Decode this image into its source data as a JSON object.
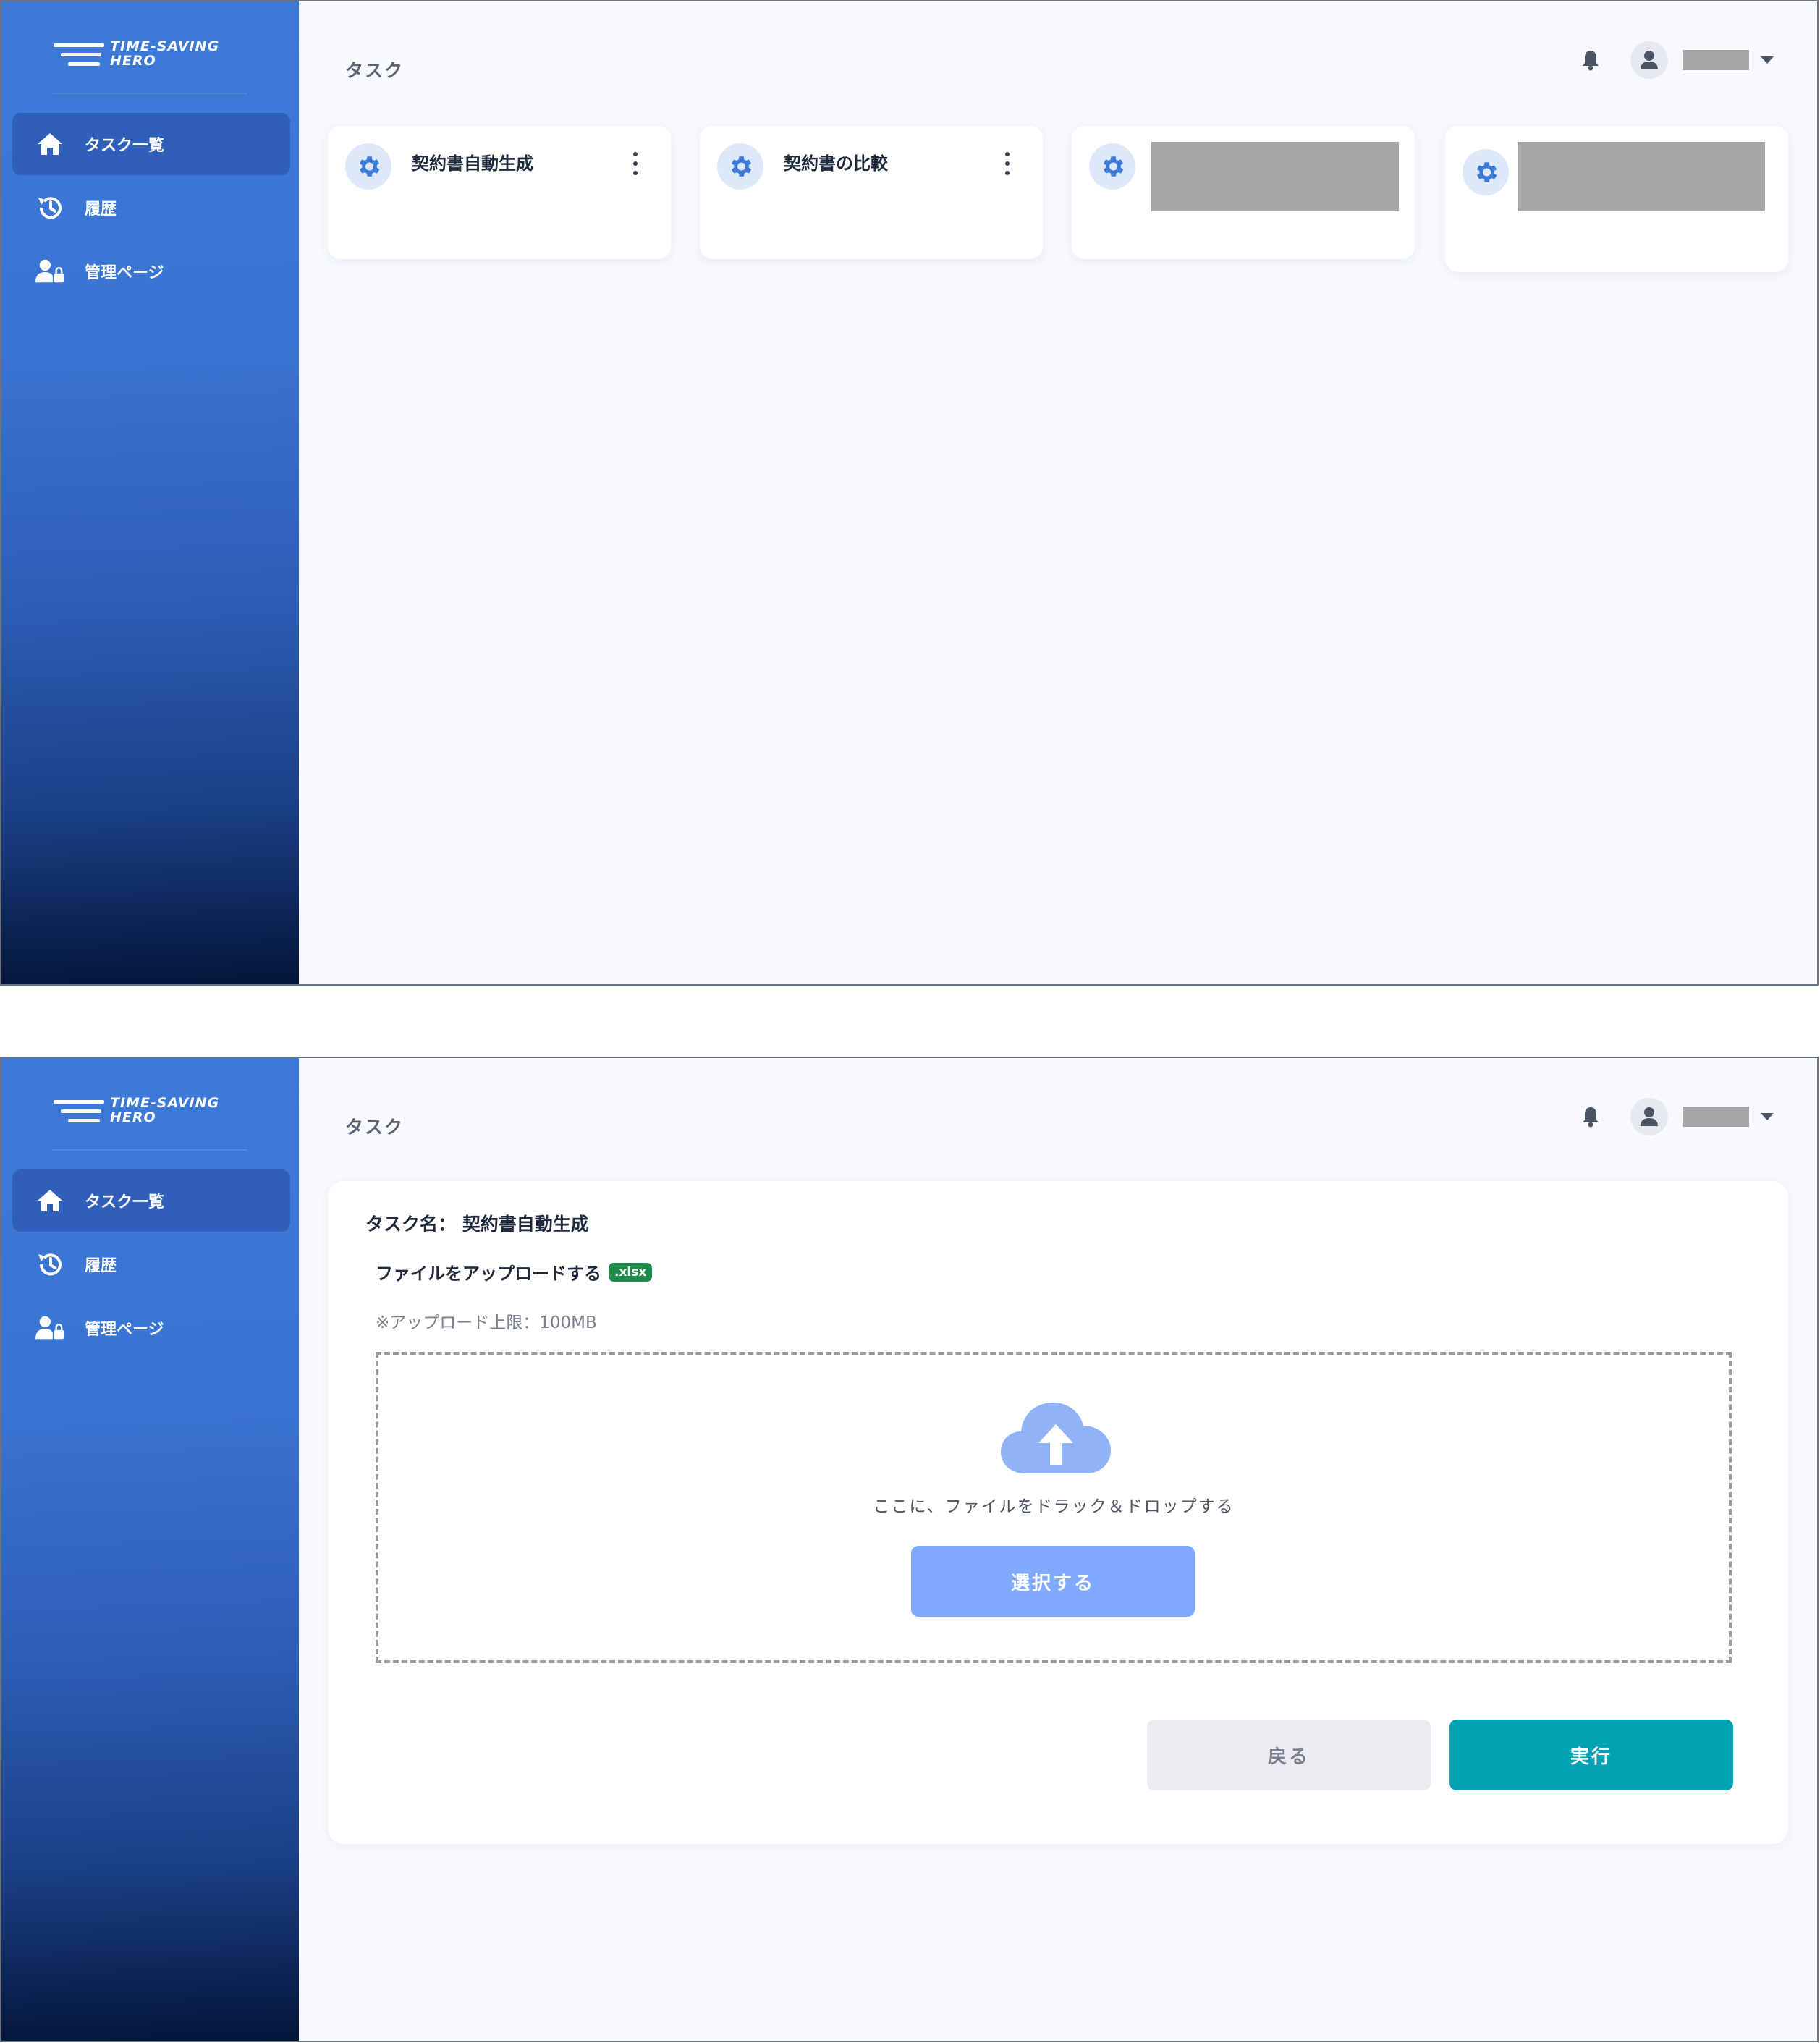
{
  "brand": {
    "line1": "TIME-SAVING",
    "line2": "HERO"
  },
  "sidebar": {
    "items": [
      {
        "label": "タスク一覧",
        "icon": "home-icon"
      },
      {
        "label": "履歴",
        "icon": "history-icon"
      },
      {
        "label": "管理ページ",
        "icon": "admin-user-lock-icon"
      }
    ]
  },
  "header": {
    "title": "タスク"
  },
  "screen1": {
    "cards": [
      {
        "title": "契約書自動生成"
      },
      {
        "title": "契約書の比較"
      },
      {
        "title": ""
      },
      {
        "title": ""
      }
    ]
  },
  "screen2": {
    "task_name": "タスク名： 契約書自動生成",
    "upload_label": "ファイルをアップロードする",
    "file_badge": ".xlsx",
    "upload_limit": "※アップロード上限：100MB",
    "drop_text": "ここに、ファイルをドラック＆ドロップする",
    "select_button": "選択する",
    "back_button": "戻る",
    "run_button": "実行"
  },
  "colors": {
    "accent": "#3d7ad8",
    "run": "#00a2b3",
    "select": "#7fa9ff",
    "badge": "#1f8a4c",
    "redacted": "#a6a6a6"
  }
}
